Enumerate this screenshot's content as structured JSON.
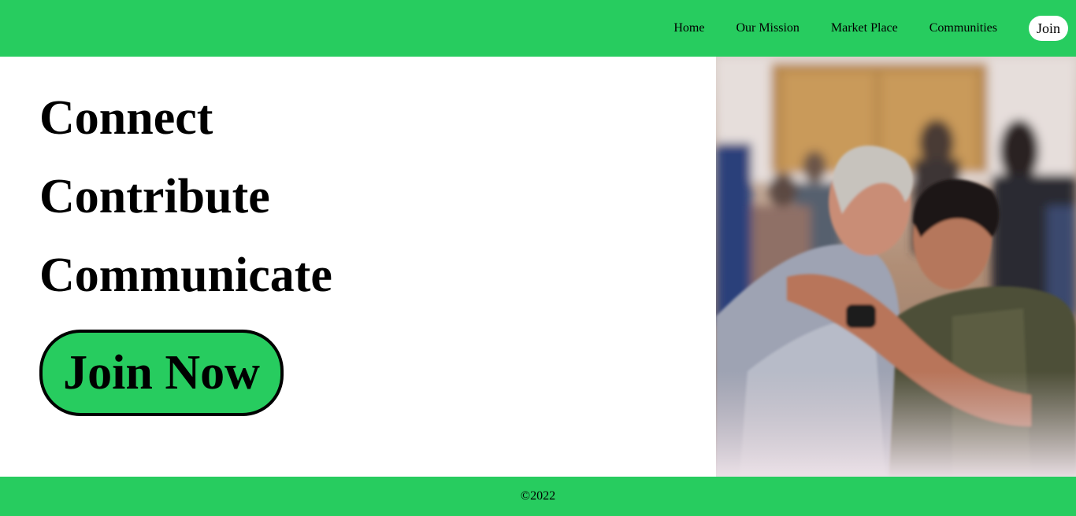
{
  "nav": {
    "items": [
      {
        "label": "Home"
      },
      {
        "label": "Our Mission"
      },
      {
        "label": "Market Place"
      },
      {
        "label": "Communities"
      }
    ],
    "join_label": "Join"
  },
  "hero": {
    "headlines": [
      "Connect",
      "Contribute",
      "Communicate"
    ],
    "cta_label": "Join Now",
    "image_alt": "two men embracing"
  },
  "footer": {
    "copyright": "©2022"
  },
  "colors": {
    "brand_green": "#27cc5f"
  }
}
